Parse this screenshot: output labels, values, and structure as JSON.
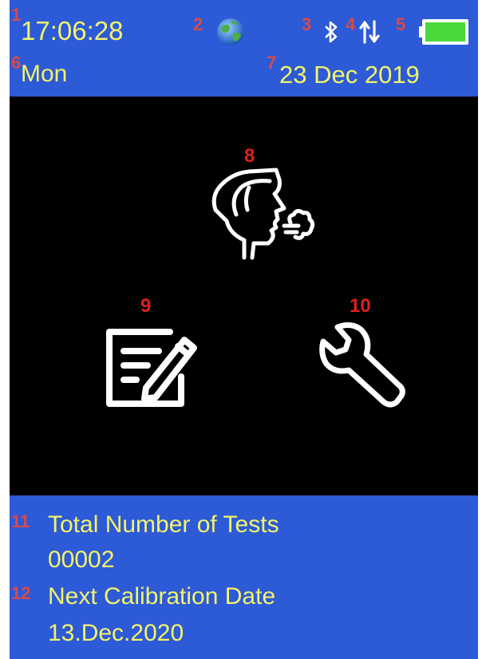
{
  "status": {
    "time": "17:06:28",
    "day": "Mon",
    "date": "23 Dec 2019",
    "network_icon": "globe-icon",
    "bluetooth_icon": "bluetooth-icon",
    "data_icon": "data-transfer-icon",
    "battery_icon": "battery-icon",
    "battery_level": 1.0,
    "battery_color": "#48d93b"
  },
  "menu": {
    "breath_test_icon": "breath-test-icon",
    "records_icon": "edit-records-icon",
    "settings_icon": "wrench-settings-icon"
  },
  "info": {
    "tests_label": "Total Number of Tests",
    "tests_value": "00002",
    "calibration_label": "Next Calibration Date",
    "calibration_value": "13.Dec.2020"
  },
  "callouts": [
    "1",
    "2",
    "3",
    "4",
    "5",
    "6",
    "7",
    "8",
    "9",
    "10",
    "11",
    "12"
  ],
  "colors": {
    "bar_background": "#2d5ad6",
    "text": "#f3f36a",
    "callout": "#e0201c",
    "screen": "#000000"
  }
}
